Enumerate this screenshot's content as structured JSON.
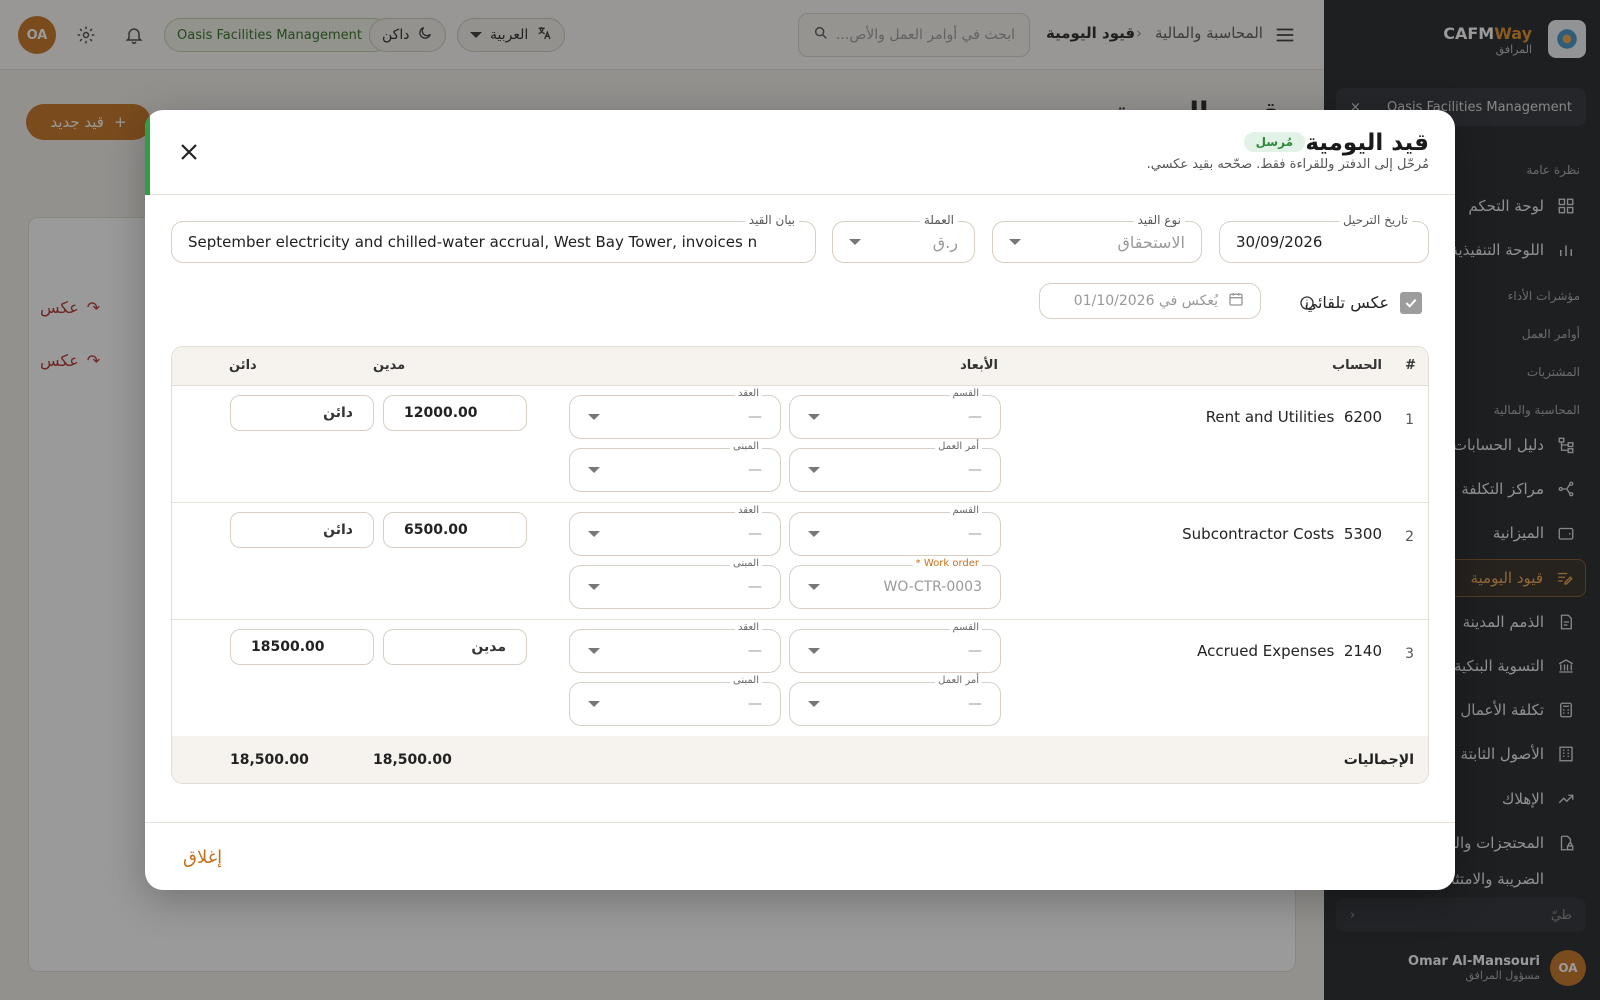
{
  "header": {
    "user_initials": "OA",
    "org_name": "Oasis Facilities Management",
    "theme_label": "داكن",
    "language_label": "العربية",
    "search_placeholder": "ابحث في أوامر العمل والأص...",
    "breadcrumb_parent": "المحاسبة والمالية",
    "breadcrumb_current": "قيود اليومية"
  },
  "background": {
    "new_button": "قيد جديد",
    "page_title": "قيود اليومية",
    "reverse_label": "عكس"
  },
  "sidebar": {
    "brand_a": "CAFM",
    "brand_b": "Way",
    "brand_sub": "المرافق",
    "org": "Oasis Facilities Management",
    "sections": {
      "overview": "نظرة عامة",
      "kpi": "مؤشرات الأداء",
      "work_orders": "أوامر العمل",
      "procurement": "المشتريات",
      "finance": "المحاسبة والمالية"
    },
    "items": [
      {
        "label": "لوحة التحكم",
        "icon": "dashboard-icon"
      },
      {
        "label": "اللوحة التنفيذية",
        "icon": "bar-chart-icon"
      },
      {
        "label": "دليل الحسابات",
        "icon": "hierarchy-icon"
      },
      {
        "label": "مراكز التكلفة",
        "icon": "network-icon"
      },
      {
        "label": "الميزانية",
        "icon": "wallet-icon"
      },
      {
        "label": "قيود اليومية",
        "icon": "edit-list-icon"
      },
      {
        "label": "الذمم المدينة",
        "icon": "document-icon"
      },
      {
        "label": "التسوية البنكية",
        "icon": "bank-icon"
      },
      {
        "label": "تكلفة الأعمال",
        "icon": "calculator-icon"
      },
      {
        "label": "الأصول الثابتة",
        "icon": "building-icon"
      },
      {
        "label": "الإهلاك",
        "icon": "trend-icon"
      },
      {
        "label": "المحتجزات والضمانات",
        "icon": "lock-file-icon"
      },
      {
        "label": "الضريبة والامتثال",
        "icon": "tax-icon"
      }
    ],
    "collapse_label": "طيّ",
    "user_name": "Omar Al-Mansouri",
    "user_role": "مسؤول المرافق",
    "user_initials": "OA"
  },
  "modal": {
    "title": "قيد اليومية",
    "status_badge": "مُرسل",
    "subtitle": "مُرحّل إلى الدفتر وللقراءة فقط. صحّحه بقيد عكسي.",
    "fields": {
      "posting_date_label": "تاريخ الترحيل",
      "posting_date": "30/09/2026",
      "entry_type_label": "نوع القيد",
      "entry_type": "الاستحقاق",
      "currency_label": "العملة",
      "currency": "ر.ق",
      "description_label": "بيان القيد",
      "description": "September electricity and chilled-water accrual, West Bay Tower, invoices n"
    },
    "auto_reverse_label": "عكس تلقائي",
    "reverse_date_placeholder": "يُعكس في 01/10/2026",
    "table": {
      "headers": {
        "num": "#",
        "account": "الحساب",
        "dimensions": "الأبعاد",
        "debit": "مدين",
        "credit": "دائن"
      },
      "dim_labels": {
        "division": "القسم",
        "contract": "العقد",
        "work_order": "أمر العمل",
        "building": "المبنى",
        "work_order_en": "Work order *"
      },
      "rows": [
        {
          "num": "1",
          "code": "6200",
          "name": "Rent and Utilities",
          "division": "—",
          "contract": "—",
          "work_order": "—",
          "building": "—",
          "debit": "12000.00",
          "credit": "دائن"
        },
        {
          "num": "2",
          "code": "5300",
          "name": "Subcontractor Costs",
          "division": "—",
          "contract": "—",
          "work_order": "WO-CTR-0003",
          "building": "—",
          "debit": "6500.00",
          "credit": "دائن"
        },
        {
          "num": "3",
          "code": "2140",
          "name": "Accrued Expenses",
          "division": "—",
          "contract": "—",
          "work_order": "—",
          "building": "—",
          "debit": "مدين",
          "credit": "18500.00"
        }
      ],
      "totals_label": "الإجماليات",
      "total_debit": "18,500.00",
      "total_credit": "18,500.00"
    },
    "close_button": "إغلاق"
  },
  "colors": {
    "accent": "#c3701c",
    "success": "#2f9e44",
    "sidebar_bg": "#1d1f24"
  }
}
